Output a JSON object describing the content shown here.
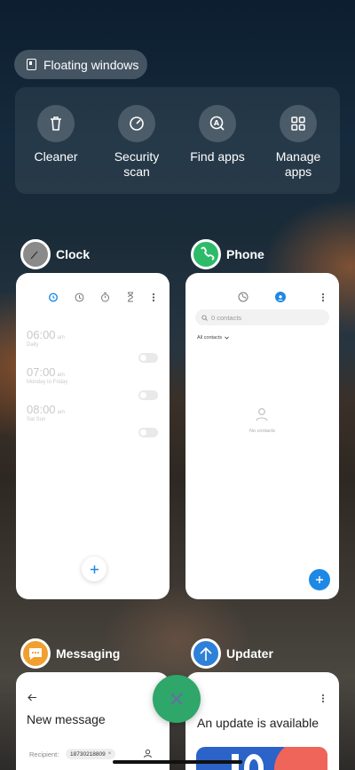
{
  "floating": {
    "label": "Floating windows",
    "icon": "floating-window-icon"
  },
  "quick_actions": [
    {
      "label": "Cleaner",
      "icon": "trash-icon"
    },
    {
      "label": "Security\nscan",
      "icon": "security-scan-icon"
    },
    {
      "label": "Find apps",
      "icon": "find-apps-icon"
    },
    {
      "label": "Manage\napps",
      "icon": "grid-icon"
    }
  ],
  "apps": {
    "clock": {
      "name": "Clock",
      "alarms": [
        {
          "time": "06:00",
          "ampm": "am",
          "repeat": "Daily"
        },
        {
          "time": "07:00",
          "ampm": "am",
          "repeat": "Monday to Friday"
        },
        {
          "time": "08:00",
          "ampm": "am",
          "repeat": "Sat Sun"
        }
      ]
    },
    "phone": {
      "name": "Phone",
      "search_placeholder": "0 contacts",
      "filter_label": "All contacts",
      "empty_label": "No contacts"
    },
    "messaging": {
      "name": "Messaging",
      "title": "New message",
      "recipient_label": "Recipient:",
      "recipient_value": "18730218809"
    },
    "updater": {
      "name": "Updater",
      "title": "An update is available"
    }
  },
  "colors": {
    "accent_blue": "#1e88e5",
    "close_green": "#2fa66a",
    "phone_green": "#2dbb6a",
    "messaging_orange": "#f0a030",
    "updater_blue": "#2f80d8"
  }
}
